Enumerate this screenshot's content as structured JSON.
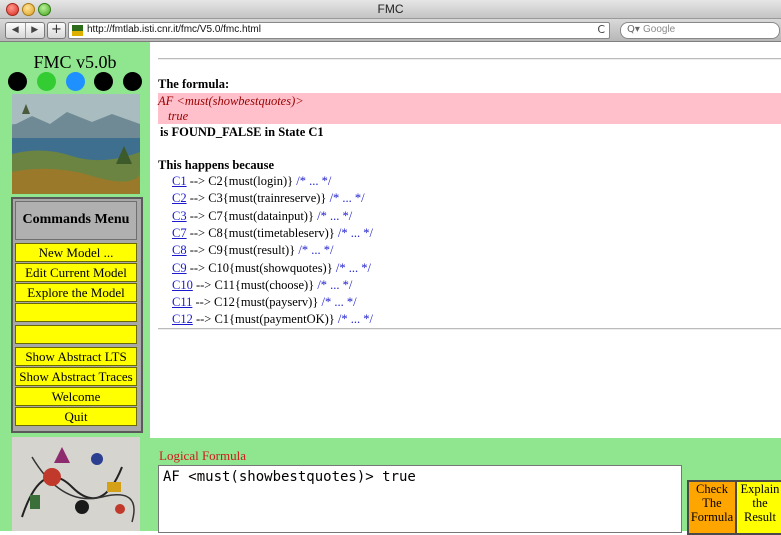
{
  "window": {
    "title": "FMC"
  },
  "browser": {
    "back_icon": "◀",
    "forward_icon": "▶",
    "add_icon": "+",
    "url": "http://fmtlab.isti.cnr.it/fmc/V5.0/fmc.html",
    "reload_icon": "C",
    "search_icon": "Q▾",
    "search_placeholder": "Google"
  },
  "sidebar": {
    "app_title": "FMC v5.0b",
    "dots": [
      "#000000",
      "#33cc33",
      "#1e90ff",
      "#000000",
      "#000000"
    ],
    "commands_header": "Commands Menu",
    "commands": [
      "New Model ...",
      "Edit Current Model",
      "Explore the Model",
      "",
      "",
      "Show Abstract LTS",
      "Show Abstract Traces",
      "Welcome",
      "Quit"
    ]
  },
  "result": {
    "heading": "The formula:",
    "formula_line1": "AF <must(showbestquotes)>",
    "formula_line2": "true",
    "verdict": "is FOUND_FALSE in State C1",
    "because": "This happens because",
    "steps": [
      {
        "state": "C1",
        "rest": "--> C2{must(login)}",
        "comment": "/* ... */"
      },
      {
        "state": "C2",
        "rest": "--> C3{must(trainreserve)}",
        "comment": "/* ... */"
      },
      {
        "state": "C3",
        "rest": "--> C7{must(datainput)}",
        "comment": "/* ... */"
      },
      {
        "state": "C7",
        "rest": "--> C8{must(timetableserv)}",
        "comment": "/* ... */"
      },
      {
        "state": "C8",
        "rest": "--> C9{must(result)}",
        "comment": "/* ... */"
      },
      {
        "state": "C9",
        "rest": "--> C10{must(showquotes)}",
        "comment": "/* ... */"
      },
      {
        "state": "C10",
        "rest": "--> C11{must(choose)}",
        "comment": "/* ... */"
      },
      {
        "state": "C11",
        "rest": "--> C12{must(payserv)}",
        "comment": "/* ... */"
      },
      {
        "state": "C12",
        "rest": "--> C1{must(paymentOK)}",
        "comment": "/* ... */"
      }
    ]
  },
  "formula_panel": {
    "label": "Logical Formula",
    "value": "AF <must(showbestquotes)> true",
    "check_lines": [
      "Check",
      "The",
      "Formula"
    ],
    "explain_lines": [
      "Explain",
      "the",
      "Result"
    ]
  }
}
